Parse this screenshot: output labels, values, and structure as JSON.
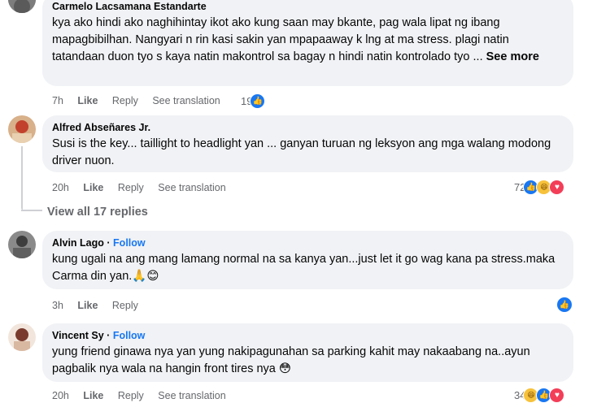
{
  "comments": [
    {
      "author": "Carmelo Lacsamana Estandarte",
      "text": "kya ako hindi ako naghihintay ikot ako kung saan may bkante, pag wala lipat ng ibang mapagbibilhan. Nangyari n rin kasi sakin yan mpapaaway k lng at ma stress. plagi natin tatandaan duon tyo s kaya natin makontrol sa bagay n hindi natin kontrolado tyo ...",
      "see_more": "See more",
      "time": "7h",
      "like": "Like",
      "reply": "Reply",
      "translate": "See translation",
      "reaction_count": "19",
      "reactions": [
        "like"
      ]
    },
    {
      "author": "Alfred Abseñares Jr.",
      "text": "Susi is the key... taillight to headlight yan ... ganyan turuan ng leksyon ang mga walang modong driver nuon.",
      "time": "20h",
      "like": "Like",
      "reply": "Reply",
      "translate": "See translation",
      "reaction_count": "72",
      "reactions": [
        "like",
        "haha",
        "love"
      ]
    },
    {
      "author": "Alvin Lago",
      "follow": "Follow",
      "text": "kung ugali na ang mang lamang normal na sa kanya yan...just let it go wag kana pa stress.maka Carma din yan.🙏😊",
      "time": "3h",
      "like": "Like",
      "reply": "Reply",
      "reaction_count": "",
      "reactions": [
        "like"
      ]
    },
    {
      "author": "Vincent Sy",
      "follow": "Follow",
      "text": "yung friend ginawa nya yan yung nakipagunahan sa parking kahit may nakaabang na..ayun pagbalik nya wala na hangin front tires nya 😳",
      "time": "20h",
      "like": "Like",
      "reply": "Reply",
      "translate": "See translation",
      "reaction_count": "34",
      "reactions": [
        "haha",
        "like",
        "love"
      ]
    }
  ],
  "view_replies": "View all 17 replies",
  "separator": "·",
  "icons": {
    "like": "like-icon",
    "haha": "haha-icon",
    "love": "love-icon"
  },
  "colors": {
    "accent": "#1877f2",
    "bubble": "#f0f2f5",
    "muted": "#65676b"
  }
}
